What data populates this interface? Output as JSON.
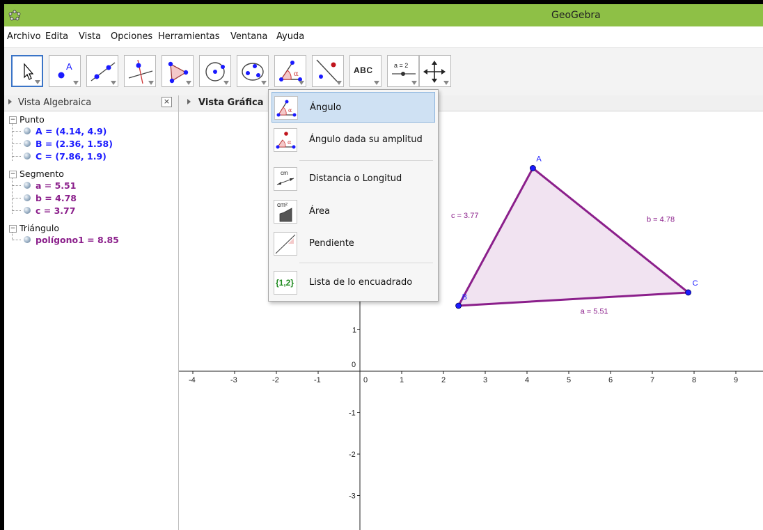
{
  "window": {
    "title": "GeoGebra"
  },
  "menu": [
    "Archivo",
    "Edita",
    "Vista",
    "Opciones",
    "Herramientas",
    "Ventana",
    "Ayuda"
  ],
  "toolbar": {
    "selected_tool": "move",
    "tools": [
      "move-tool-icon",
      "point-tool-icon",
      "line-tool-icon",
      "perpendicular-tool-icon",
      "polygon-tool-icon",
      "circle-tool-icon",
      "conic-tool-icon",
      "angle-tool-icon",
      "reflect-tool-icon",
      "text-tool-icon",
      "slider-tool-icon",
      "move-view-tool-icon"
    ],
    "text_tool_label": "ABC",
    "slider_tool_label": "a = 2"
  },
  "algebra_view": {
    "title": "Vista Algebraica",
    "close_glyph": "×",
    "groups": [
      {
        "name": "Punto",
        "color": "#1a1aff",
        "items": [
          "A = (4.14, 4.9)",
          "B = (2.36, 1.58)",
          "C = (7.86, 1.9)"
        ]
      },
      {
        "name": "Segmento",
        "color": "#8b1f8b",
        "items": [
          "a = 5.51",
          "b = 4.78",
          "c = 3.77"
        ]
      },
      {
        "name": "Triángulo",
        "color": "#8b1f8b",
        "items": [
          "polígono1 = 8.85"
        ]
      }
    ]
  },
  "graphics_view": {
    "title": "Vista Gráfica",
    "x_ticks": [
      "-4",
      "-3",
      "-2",
      "-1",
      "0",
      "1",
      "2",
      "3",
      "4",
      "5",
      "6",
      "7",
      "8",
      "9"
    ],
    "y_ticks": [
      "1",
      "0",
      "-1",
      "-2",
      "-3"
    ],
    "points": [
      {
        "name": "A",
        "x": 4.14,
        "y": 4.9
      },
      {
        "name": "B",
        "x": 2.36,
        "y": 1.58
      },
      {
        "name": "C",
        "x": 7.86,
        "y": 1.9
      }
    ],
    "segment_labels": {
      "a": "a = 5.51",
      "b": "b = 4.78",
      "c": "c = 3.77"
    },
    "polygon_color": "#8b1f8b",
    "polygon_fill": "#f0e0f0",
    "point_color": "#1a1aff"
  },
  "dropdown": {
    "groups": [
      [
        "Ángulo",
        "Ángulo dada su amplitud"
      ],
      [
        "Distancia o Longitud",
        "Área",
        "Pendiente"
      ],
      [
        "Lista de lo encuadrado"
      ]
    ],
    "highlighted": "Ángulo",
    "icon_labels": {
      "distance": "cm",
      "area": "cm²",
      "list": "{1,2}"
    }
  }
}
